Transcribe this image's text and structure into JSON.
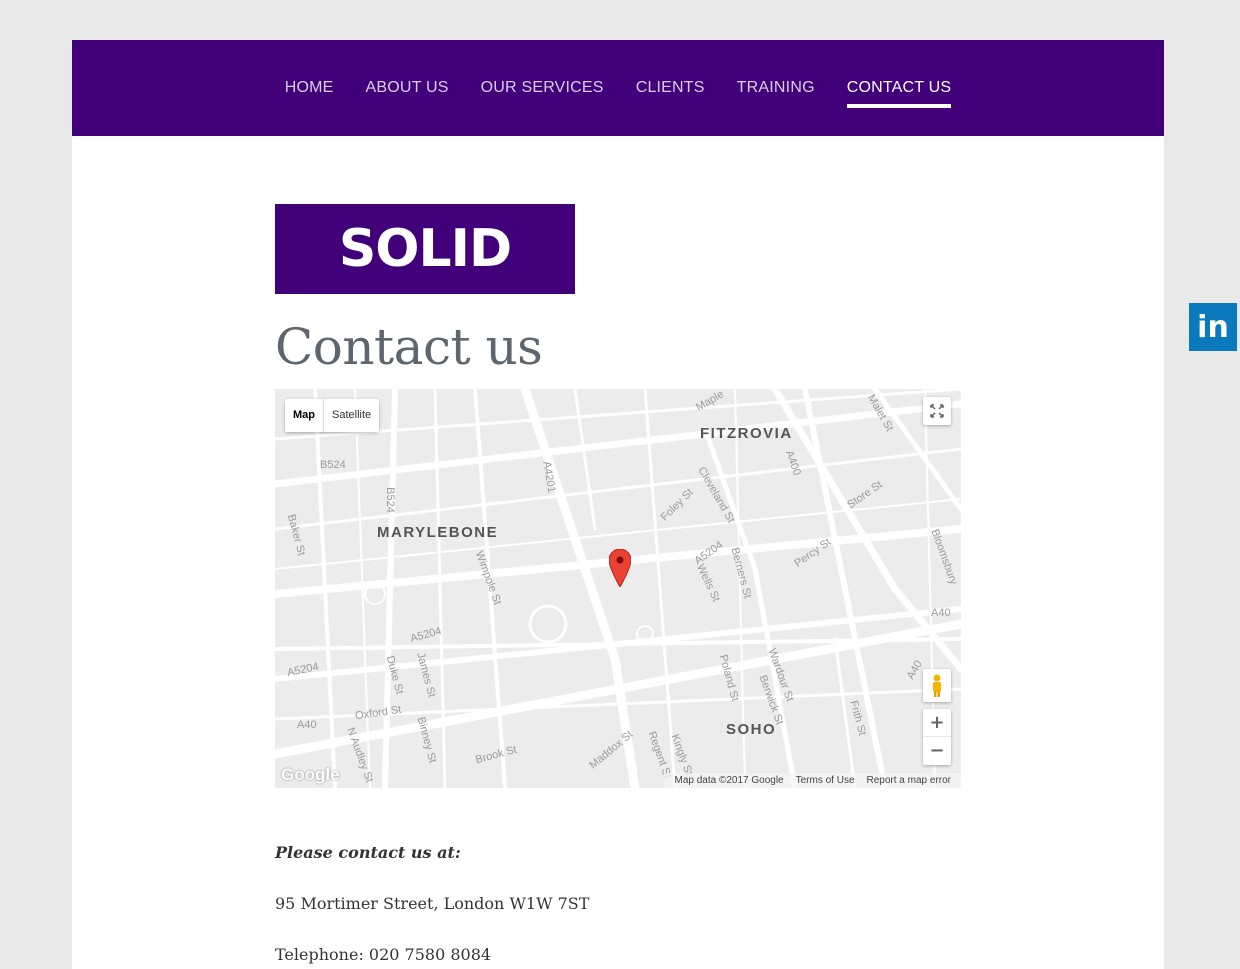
{
  "nav": {
    "items": [
      {
        "label": "HOME"
      },
      {
        "label": "ABOUT US"
      },
      {
        "label": "OUR SERVICES"
      },
      {
        "label": "CLIENTS"
      },
      {
        "label": "TRAINING"
      },
      {
        "label": "CONTACT US",
        "active": true
      }
    ]
  },
  "logo": {
    "text": "SOLID"
  },
  "page": {
    "title": "Contact us"
  },
  "map": {
    "type_buttons": {
      "map": "Map",
      "satellite": "Satellite"
    },
    "districts": {
      "fitzrovia": "FITZROVIA",
      "marylebone": "MARYLEBONE",
      "soho": "SOHO"
    },
    "streets": {
      "B524_a": "B524",
      "B524_b": "B524",
      "A4201": "A4201",
      "A400": "A400",
      "A5204_a": "A5204",
      "A5204_b": "A5204",
      "A5204_c": "A5204",
      "A40_a": "A40",
      "A40_b": "A40",
      "A40_c": "A40",
      "baker": "Baker St",
      "wimpole": "Wimpole St",
      "duke": "Duke St",
      "james": "James St",
      "oxford": "Oxford St",
      "brook": "Brook St",
      "maddox": "Maddox St",
      "regent": "Regent St",
      "kingly": "Kingly St",
      "poland": "Poland St",
      "wardour": "Wardour St",
      "berwick": "Berwick St",
      "frith": "Frith St",
      "berners": "Berners St",
      "wells": "Wells St",
      "cleveland": "Cleveland St",
      "foley": "Foley St",
      "percy": "Percy St",
      "store": "Store St",
      "malet": "Malet St",
      "maple": "Maple",
      "bloomsbury": "Bloomsbury",
      "binney": "Binney St",
      "nAudley": "N Audley St"
    },
    "zoom_in": "+",
    "zoom_out": "−",
    "google": "Google",
    "footer": {
      "data": "Map data ©2017 Google",
      "terms": "Terms of Use",
      "report": "Report a map error"
    }
  },
  "contact": {
    "intro": "Please contact us at:",
    "address": "95 Mortimer Street, London W1W 7ST",
    "phone": "Telephone: 020 7580 8084"
  },
  "social": {
    "linkedin": "in"
  },
  "colors": {
    "brand": "#41007a",
    "linkedin": "#0a79bd",
    "marker": "#ea4335"
  }
}
